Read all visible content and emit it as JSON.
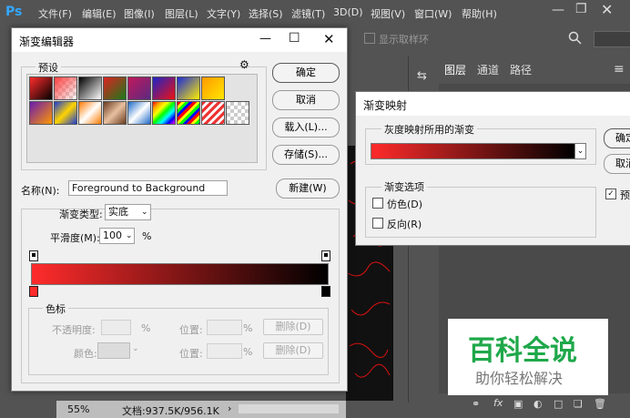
{
  "ps": {
    "logo": "Ps",
    "menus": [
      "文件(F)",
      "编辑(E)",
      "图像(I)",
      "图层(L)",
      "文字(Y)",
      "选择(S)",
      "滤镜(T)",
      "3D(D)",
      "视图(V)",
      "窗口(W)",
      "帮助(H)"
    ],
    "option_show_ring": "显示取样环",
    "status_zoom": "55%",
    "status_doc": "文档:937.5K/956.1K",
    "panel_tabs": [
      "图层",
      "通道",
      "路径"
    ]
  },
  "gradient_editor": {
    "title": "渐变编辑器",
    "presets_label": "预设",
    "buttons": {
      "ok": "确定",
      "cancel": "取消",
      "load": "载入(L)...",
      "save": "存储(S)...",
      "new": "新建(W)"
    },
    "name_label": "名称(N):",
    "name_value": "Foreground to Background",
    "type_label": "渐变类型:",
    "type_value": "实底",
    "smooth_label": "平滑度(M):",
    "smooth_value": "100",
    "percent": "%",
    "stops_label": "色标",
    "opacity_label": "不透明度:",
    "color_label": "颜色:",
    "location_label": "位置:",
    "delete_label": "删除(D)"
  },
  "gradient_map": {
    "title": "渐变映射",
    "group_label": "灰度映射所用的渐变",
    "options_label": "渐变选项",
    "dither_label": "仿色(D)",
    "reverse_label": "反向(R)",
    "ok_partial": "确定",
    "cancel_partial": "取消",
    "preview_partial": "预"
  },
  "watermark": {
    "title": "百科全说",
    "subtitle": "助你轻松解决"
  },
  "colors": {
    "start": "#ff2b2b",
    "end": "#000000"
  }
}
